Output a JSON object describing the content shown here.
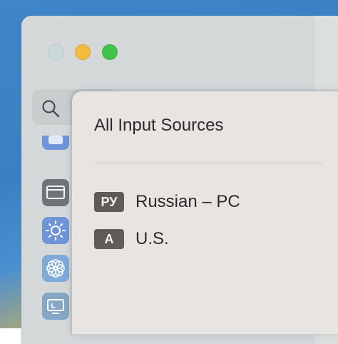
{
  "popup": {
    "title": "All Input Sources",
    "sources": [
      {
        "badge": "РУ",
        "label": "Russian – PC"
      },
      {
        "badge": "A",
        "label": "U.S."
      }
    ]
  },
  "window": {
    "traffic_lights": [
      "close",
      "minimize",
      "zoom"
    ],
    "sidebar_icons": [
      "partial-icon",
      "display-icon",
      "brightness-icon",
      "flower-icon",
      "screen-saver-icon"
    ]
  },
  "colors": {
    "popup_bg": "#e8e4e1",
    "badge_bg": "#5f5b58",
    "minimize": "#f2bd3d",
    "zoom": "#40c449"
  }
}
